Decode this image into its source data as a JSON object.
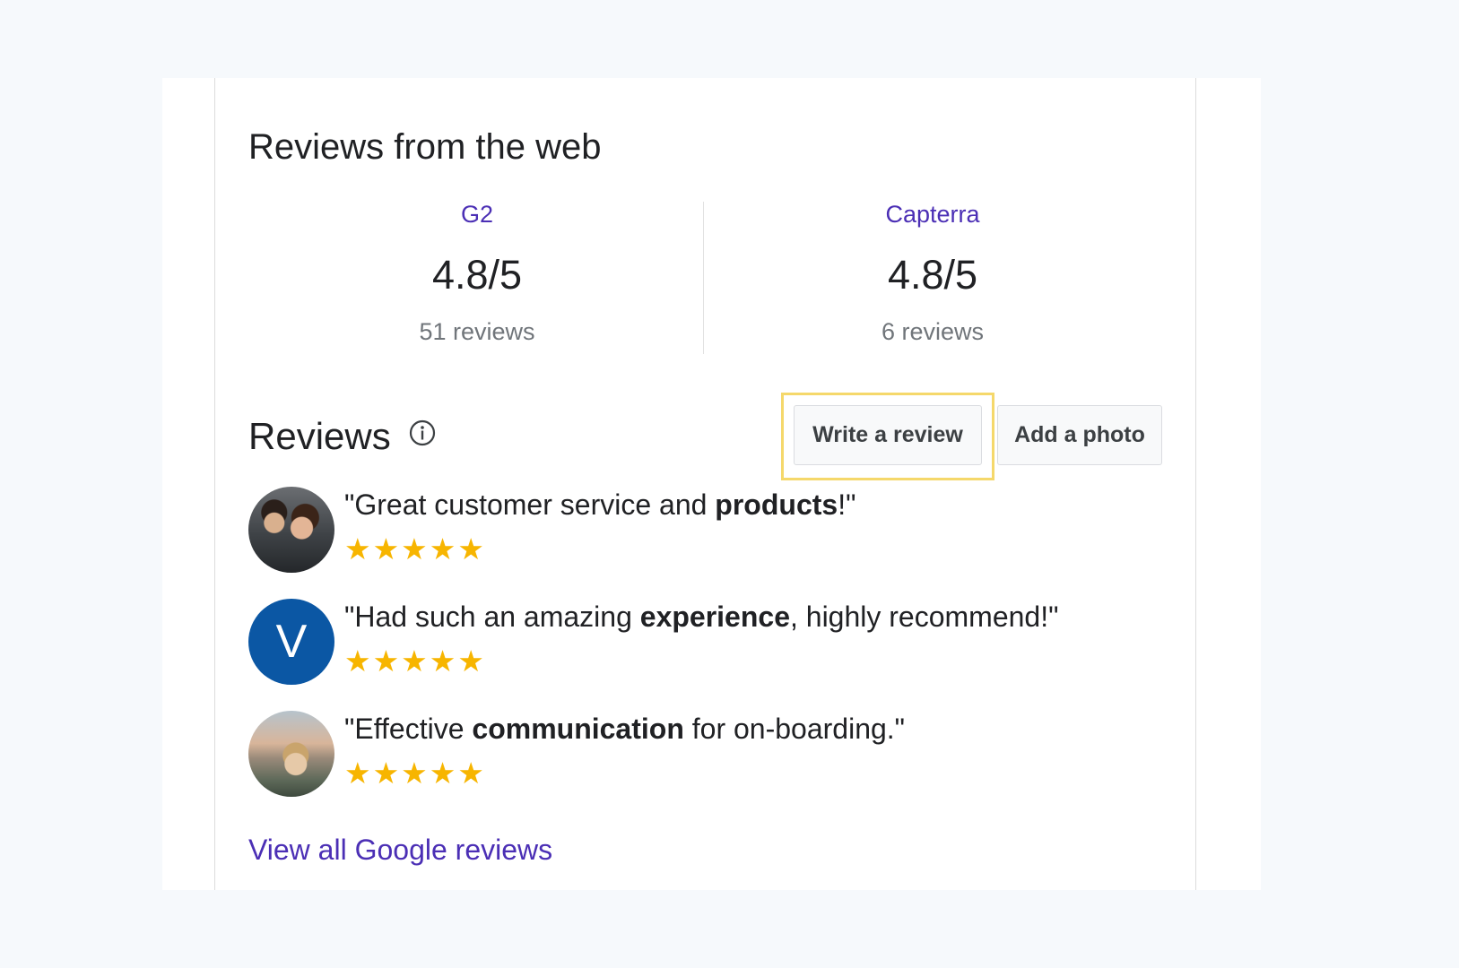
{
  "web_reviews": {
    "title": "Reviews from the web",
    "sources": [
      {
        "name": "G2",
        "score": "4.8/5",
        "count": "51 reviews"
      },
      {
        "name": "Capterra",
        "score": "4.8/5",
        "count": "6 reviews"
      }
    ]
  },
  "reviews": {
    "title": "Reviews",
    "info_icon": "info-circle-icon",
    "write_review_label": "Write a review",
    "add_photo_label": "Add a photo",
    "highlight_color": "#f5d86b",
    "items": [
      {
        "avatar": "photo",
        "before": "\"Great customer service and ",
        "bold": "products",
        "after": "!\"",
        "rating": 5,
        "stars": "★★★★★"
      },
      {
        "avatar": "V",
        "avatar_color": "#0b57a4",
        "before": "\"Had such an amazing ",
        "bold": "experience",
        "after": ", highly recommend!\"",
        "rating": 5,
        "stars": "★★★★★"
      },
      {
        "avatar": "photo",
        "before": "\"Effective ",
        "bold": "communication",
        "after": " for on-boarding.\"",
        "rating": 5,
        "stars": "★★★★★"
      }
    ],
    "view_all_label": "View all Google reviews"
  },
  "colors": {
    "link": "#4b2fb5",
    "star": "#f7b500",
    "background": "#f6f9fc"
  }
}
